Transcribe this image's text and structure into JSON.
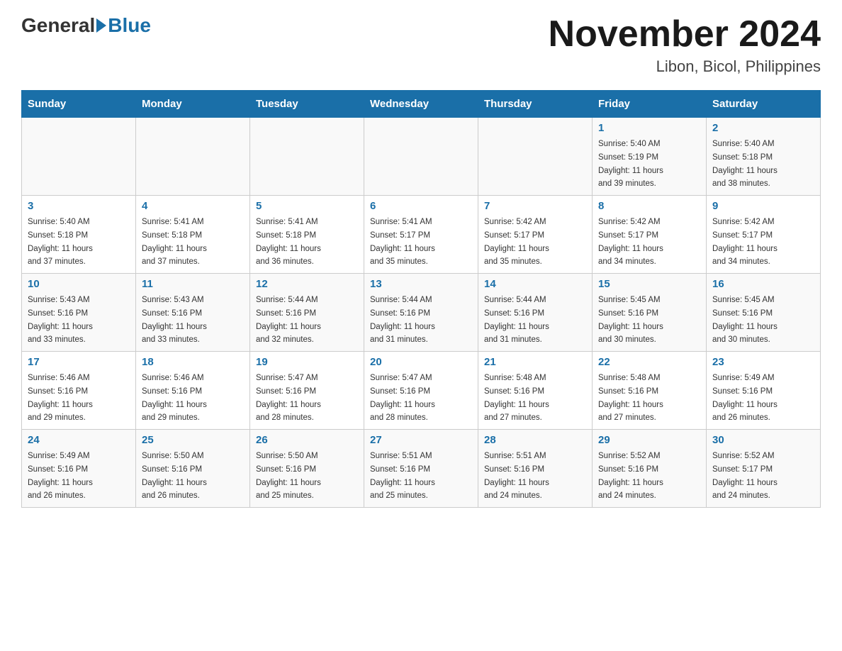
{
  "header": {
    "logo_general": "General",
    "logo_blue": "Blue",
    "title": "November 2024",
    "location": "Libon, Bicol, Philippines"
  },
  "weekdays": [
    "Sunday",
    "Monday",
    "Tuesday",
    "Wednesday",
    "Thursday",
    "Friday",
    "Saturday"
  ],
  "weeks": [
    [
      {
        "day": "",
        "info": ""
      },
      {
        "day": "",
        "info": ""
      },
      {
        "day": "",
        "info": ""
      },
      {
        "day": "",
        "info": ""
      },
      {
        "day": "",
        "info": ""
      },
      {
        "day": "1",
        "info": "Sunrise: 5:40 AM\nSunset: 5:19 PM\nDaylight: 11 hours\nand 39 minutes."
      },
      {
        "day": "2",
        "info": "Sunrise: 5:40 AM\nSunset: 5:18 PM\nDaylight: 11 hours\nand 38 minutes."
      }
    ],
    [
      {
        "day": "3",
        "info": "Sunrise: 5:40 AM\nSunset: 5:18 PM\nDaylight: 11 hours\nand 37 minutes."
      },
      {
        "day": "4",
        "info": "Sunrise: 5:41 AM\nSunset: 5:18 PM\nDaylight: 11 hours\nand 37 minutes."
      },
      {
        "day": "5",
        "info": "Sunrise: 5:41 AM\nSunset: 5:18 PM\nDaylight: 11 hours\nand 36 minutes."
      },
      {
        "day": "6",
        "info": "Sunrise: 5:41 AM\nSunset: 5:17 PM\nDaylight: 11 hours\nand 35 minutes."
      },
      {
        "day": "7",
        "info": "Sunrise: 5:42 AM\nSunset: 5:17 PM\nDaylight: 11 hours\nand 35 minutes."
      },
      {
        "day": "8",
        "info": "Sunrise: 5:42 AM\nSunset: 5:17 PM\nDaylight: 11 hours\nand 34 minutes."
      },
      {
        "day": "9",
        "info": "Sunrise: 5:42 AM\nSunset: 5:17 PM\nDaylight: 11 hours\nand 34 minutes."
      }
    ],
    [
      {
        "day": "10",
        "info": "Sunrise: 5:43 AM\nSunset: 5:16 PM\nDaylight: 11 hours\nand 33 minutes."
      },
      {
        "day": "11",
        "info": "Sunrise: 5:43 AM\nSunset: 5:16 PM\nDaylight: 11 hours\nand 33 minutes."
      },
      {
        "day": "12",
        "info": "Sunrise: 5:44 AM\nSunset: 5:16 PM\nDaylight: 11 hours\nand 32 minutes."
      },
      {
        "day": "13",
        "info": "Sunrise: 5:44 AM\nSunset: 5:16 PM\nDaylight: 11 hours\nand 31 minutes."
      },
      {
        "day": "14",
        "info": "Sunrise: 5:44 AM\nSunset: 5:16 PM\nDaylight: 11 hours\nand 31 minutes."
      },
      {
        "day": "15",
        "info": "Sunrise: 5:45 AM\nSunset: 5:16 PM\nDaylight: 11 hours\nand 30 minutes."
      },
      {
        "day": "16",
        "info": "Sunrise: 5:45 AM\nSunset: 5:16 PM\nDaylight: 11 hours\nand 30 minutes."
      }
    ],
    [
      {
        "day": "17",
        "info": "Sunrise: 5:46 AM\nSunset: 5:16 PM\nDaylight: 11 hours\nand 29 minutes."
      },
      {
        "day": "18",
        "info": "Sunrise: 5:46 AM\nSunset: 5:16 PM\nDaylight: 11 hours\nand 29 minutes."
      },
      {
        "day": "19",
        "info": "Sunrise: 5:47 AM\nSunset: 5:16 PM\nDaylight: 11 hours\nand 28 minutes."
      },
      {
        "day": "20",
        "info": "Sunrise: 5:47 AM\nSunset: 5:16 PM\nDaylight: 11 hours\nand 28 minutes."
      },
      {
        "day": "21",
        "info": "Sunrise: 5:48 AM\nSunset: 5:16 PM\nDaylight: 11 hours\nand 27 minutes."
      },
      {
        "day": "22",
        "info": "Sunrise: 5:48 AM\nSunset: 5:16 PM\nDaylight: 11 hours\nand 27 minutes."
      },
      {
        "day": "23",
        "info": "Sunrise: 5:49 AM\nSunset: 5:16 PM\nDaylight: 11 hours\nand 26 minutes."
      }
    ],
    [
      {
        "day": "24",
        "info": "Sunrise: 5:49 AM\nSunset: 5:16 PM\nDaylight: 11 hours\nand 26 minutes."
      },
      {
        "day": "25",
        "info": "Sunrise: 5:50 AM\nSunset: 5:16 PM\nDaylight: 11 hours\nand 26 minutes."
      },
      {
        "day": "26",
        "info": "Sunrise: 5:50 AM\nSunset: 5:16 PM\nDaylight: 11 hours\nand 25 minutes."
      },
      {
        "day": "27",
        "info": "Sunrise: 5:51 AM\nSunset: 5:16 PM\nDaylight: 11 hours\nand 25 minutes."
      },
      {
        "day": "28",
        "info": "Sunrise: 5:51 AM\nSunset: 5:16 PM\nDaylight: 11 hours\nand 24 minutes."
      },
      {
        "day": "29",
        "info": "Sunrise: 5:52 AM\nSunset: 5:16 PM\nDaylight: 11 hours\nand 24 minutes."
      },
      {
        "day": "30",
        "info": "Sunrise: 5:52 AM\nSunset: 5:17 PM\nDaylight: 11 hours\nand 24 minutes."
      }
    ]
  ]
}
